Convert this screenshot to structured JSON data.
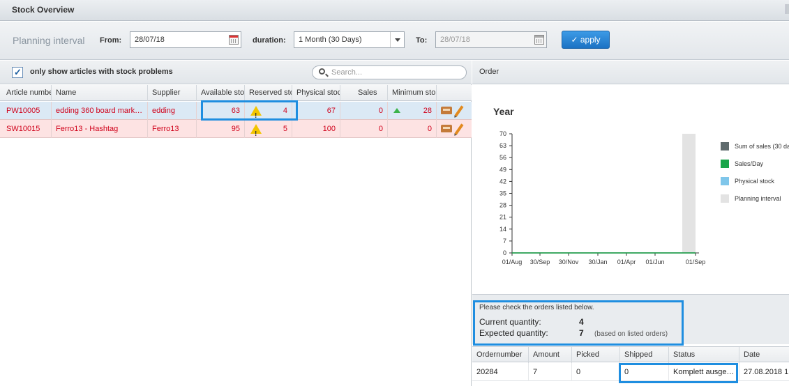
{
  "window": {
    "title": "Stock Overview"
  },
  "toolbar": {
    "planning_label": "Planning interval",
    "from_label": "From:",
    "from_value": "28/07/18",
    "duration_label": "duration:",
    "duration_value": "1 Month (30 Days)",
    "to_label": "To:",
    "to_value": "28/07/18",
    "apply_label": "✓ apply"
  },
  "filter": {
    "checkbox_checked": true,
    "checkbox_label": "only show articles with stock problems",
    "search_placeholder": "Search..."
  },
  "articles": {
    "columns": [
      "Article numbe",
      "Name",
      "Supplier",
      "Available sto",
      "Reserved sto",
      "Physical stoc",
      "Sales",
      "Minimum sto",
      ""
    ],
    "rows": [
      {
        "article": "PW10005",
        "name": "edding 360 board mark…",
        "supplier": "edding",
        "available": "63",
        "reserved": "4",
        "physical": "67",
        "sales": "0",
        "minimum": "28",
        "minimum_trend": "up-arrow-icon"
      },
      {
        "article": "SW10015",
        "name": "Ferro13 - Hashtag",
        "supplier": "Ferro13",
        "available": "95",
        "reserved": "5",
        "physical": "100",
        "sales": "0",
        "minimum": "0",
        "minimum_trend": ""
      }
    ]
  },
  "order_panel": {
    "header": "Order",
    "message": "Please check the orders listed below.",
    "current_label": "Current quantity:",
    "current_value": "4",
    "expected_label": "Expected quantity:",
    "expected_value": "7",
    "expected_note": "(based on listed orders)",
    "columns": [
      "Ordernumber",
      "Amount",
      "Picked",
      "Shipped",
      "Status",
      "Date"
    ],
    "rows": [
      {
        "ordernumber": "20284",
        "amount": "7",
        "picked": "0",
        "shipped": "0",
        "status": "Komplett ausge…",
        "date": "27.08.2018 1"
      }
    ]
  },
  "chart_data": {
    "type": "bar",
    "title": "Year",
    "x_ticks": [
      "01/Aug",
      "30/Sep",
      "30/Nov",
      "30/Jan",
      "01/Apr",
      "01/Jun",
      "01/Sep"
    ],
    "y_ticks": [
      0,
      7,
      14,
      21,
      28,
      35,
      42,
      49,
      56,
      63,
      70
    ],
    "ylim": [
      0,
      70
    ],
    "series": [
      {
        "name": "Sum of sales (30 da",
        "color": "#5f6b6d",
        "values": [
          0,
          0,
          0,
          0,
          0,
          0,
          0
        ]
      },
      {
        "name": "Sales/Day",
        "color": "#1aa54a",
        "values": [
          0,
          0,
          0,
          0,
          0,
          0,
          0
        ]
      },
      {
        "name": "Physical stock",
        "color": "#7fc6ea",
        "values": []
      },
      {
        "name": "Planning interval",
        "color": "#e3e3e3",
        "values": []
      }
    ],
    "planning_interval": {
      "x_start": "31/Jul",
      "x_end": "01/Sep",
      "value": 70
    },
    "legend": "right",
    "grid": false
  },
  "colors": {
    "accent": "#1f8ee0",
    "problem_text": "#d0021b"
  }
}
